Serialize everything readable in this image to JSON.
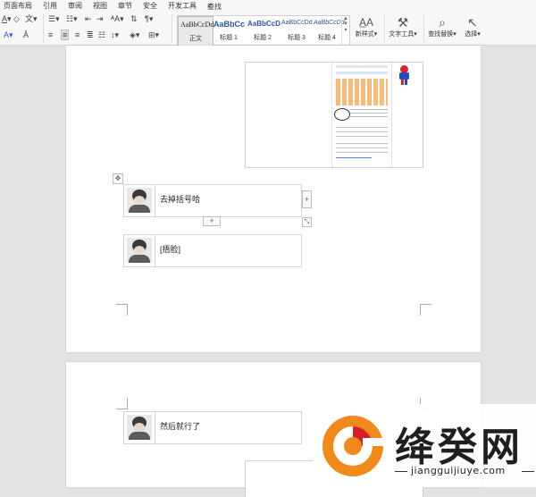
{
  "menu": {
    "items": [
      "页面布局",
      "引用",
      "审阅",
      "视图",
      "章节",
      "安全",
      "开发工具"
    ],
    "search_label": "查找"
  },
  "ribbon": {
    "styles": [
      {
        "preview": "AaBbCcDd",
        "name": "正文",
        "preview_color": "#222222"
      },
      {
        "preview": "AaBbCc",
        "name": "标题 1",
        "preview_color": "#2b579a"
      },
      {
        "preview": "AaBbCcD",
        "name": "标题 2",
        "preview_color": "#2b579a"
      },
      {
        "preview": "AaBbCcDd",
        "name": "标题 3",
        "preview_color": "#2b579a"
      },
      {
        "preview": "AaBbCcDd",
        "name": "标题 4",
        "preview_color": "#2b579a"
      }
    ],
    "new_style_label": "新样式",
    "text_tools_label": "文字工具",
    "find_replace_label": "查找替换",
    "select_label": "选择"
  },
  "doc": {
    "messages": [
      "去掉括号哈",
      "[捂脸]",
      "然后就行了"
    ]
  },
  "watermark": {
    "title": "绛癸网",
    "url": "jiangguijiuye.com",
    "brand_orange": "#f08a1c"
  },
  "colors": {
    "app_bg": "#e3e3e3",
    "toolbar_bg": "#f7f7f7",
    "page_bg": "#ffffff"
  }
}
